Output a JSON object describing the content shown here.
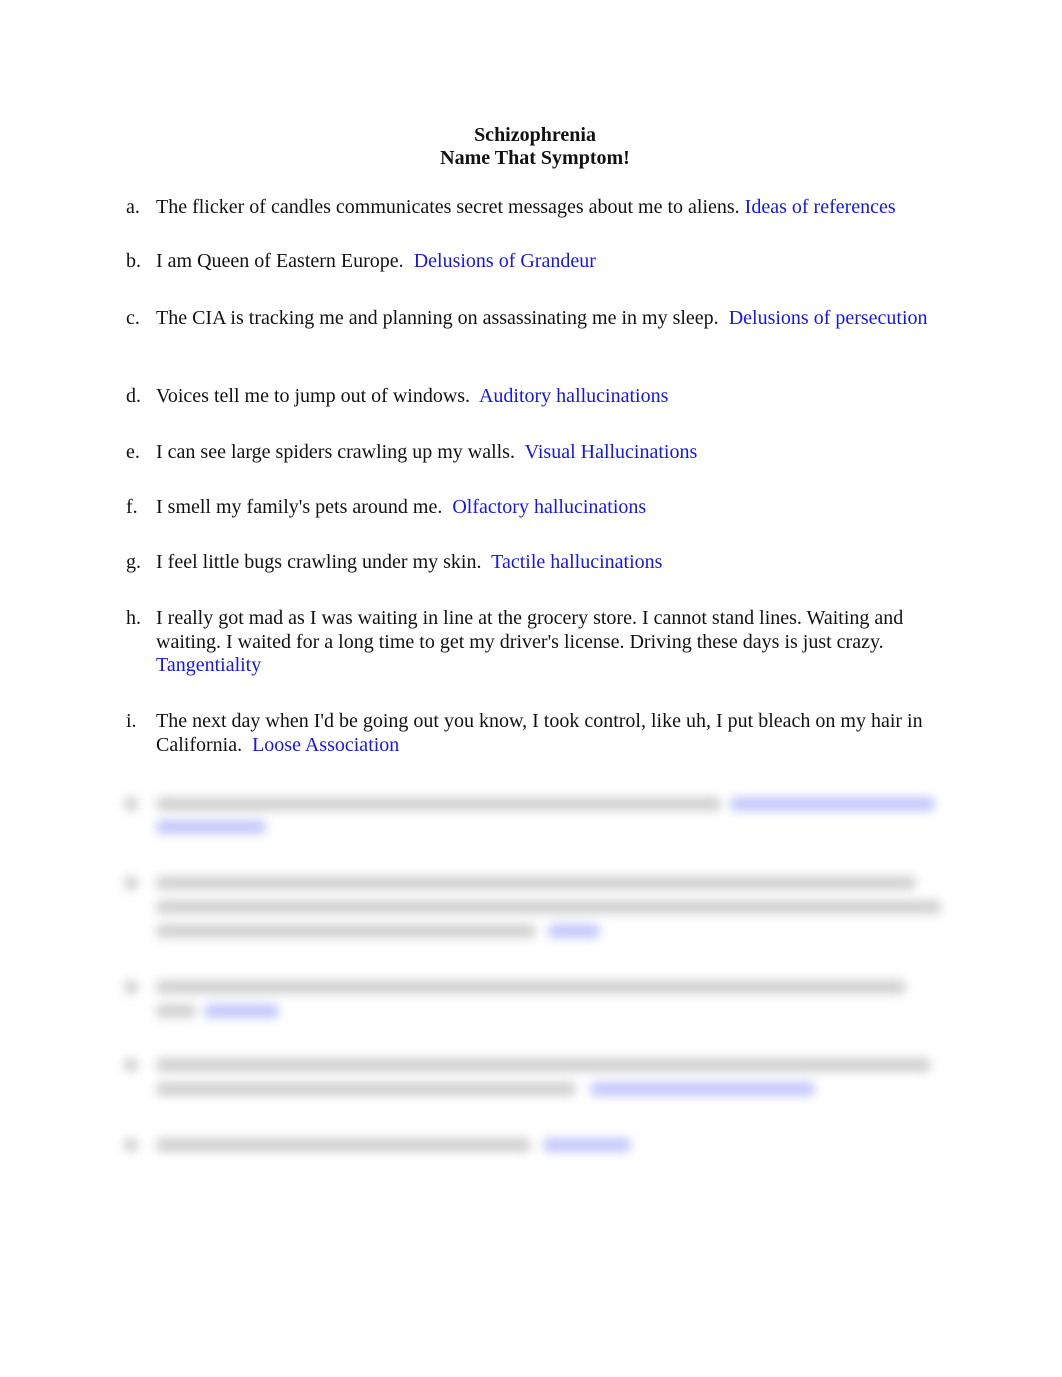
{
  "document": {
    "title": "Schizophrenia",
    "subtitle": "Name That Symptom!",
    "answer_color": "#1515f0",
    "items": [
      {
        "letter": "a.",
        "statement": "The flicker of candles communicates secret messages about me to aliens.",
        "answer": "Ideas of references"
      },
      {
        "letter": "b.",
        "statement": "I am Queen of Eastern Europe.",
        "answer": "Delusions of Grandeur"
      },
      {
        "letter": "c.",
        "statement": "The CIA is tracking me and planning on assassinating me in my sleep.",
        "answer": "Delusions of persecution"
      },
      {
        "letter": "d.",
        "statement": "Voices tell me to jump out of windows.",
        "answer": "Auditory hallucinations"
      },
      {
        "letter": "e.",
        "statement": "I can see large spiders crawling up my walls.",
        "answer": "Visual Hallucinations"
      },
      {
        "letter": "f.",
        "statement": "I smell my family's pets around me.",
        "answer": "Olfactory hallucinations"
      },
      {
        "letter": "g.",
        "statement": "I feel little bugs crawling under my skin.",
        "answer": "Tactile hallucinations"
      },
      {
        "letter": "h.",
        "statement": "I really got mad as I was waiting in line at the grocery store. I cannot stand lines. Waiting and waiting. I waited for a long time to get my driver's license. Driving these days is just crazy.",
        "answer": "Tangentiality"
      },
      {
        "letter": "i.",
        "statement": "The next day when I'd be going out you know, I took control, like uh, I put bleach on my hair in California.",
        "answer": "Loose Association"
      }
    ]
  }
}
